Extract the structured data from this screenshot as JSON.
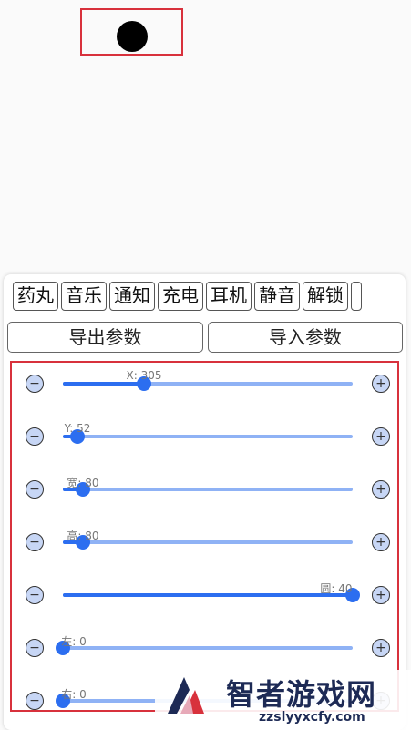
{
  "tabs": [
    {
      "label": "药丸"
    },
    {
      "label": "音乐"
    },
    {
      "label": "通知"
    },
    {
      "label": "充电"
    },
    {
      "label": "耳机"
    },
    {
      "label": "静音"
    },
    {
      "label": "解锁"
    },
    {
      "label": ""
    }
  ],
  "actions": {
    "export_label": "导出参数",
    "import_label": "导入参数"
  },
  "controls": {
    "minus_symbol": "−",
    "plus_symbol": "+"
  },
  "sliders": [
    {
      "label": "X: 305",
      "fraction": 0.28
    },
    {
      "label": "Y: 52",
      "fraction": 0.05
    },
    {
      "label": "宽: 80",
      "fraction": 0.07
    },
    {
      "label": "高: 80",
      "fraction": 0.07
    },
    {
      "label": "圆: 40",
      "fraction": 1.0
    },
    {
      "label": "左: 0",
      "fraction": 0.0
    },
    {
      "label": "右: 0",
      "fraction": 0.0
    }
  ],
  "watermark": {
    "title": "智者游戏网",
    "url": "zzslyyxcfy.com"
  },
  "colors": {
    "accent": "#2c6ef0",
    "track": "#8fb2f5",
    "highlight_border": "#d8313c",
    "button_fill": "#c7d6f5"
  }
}
